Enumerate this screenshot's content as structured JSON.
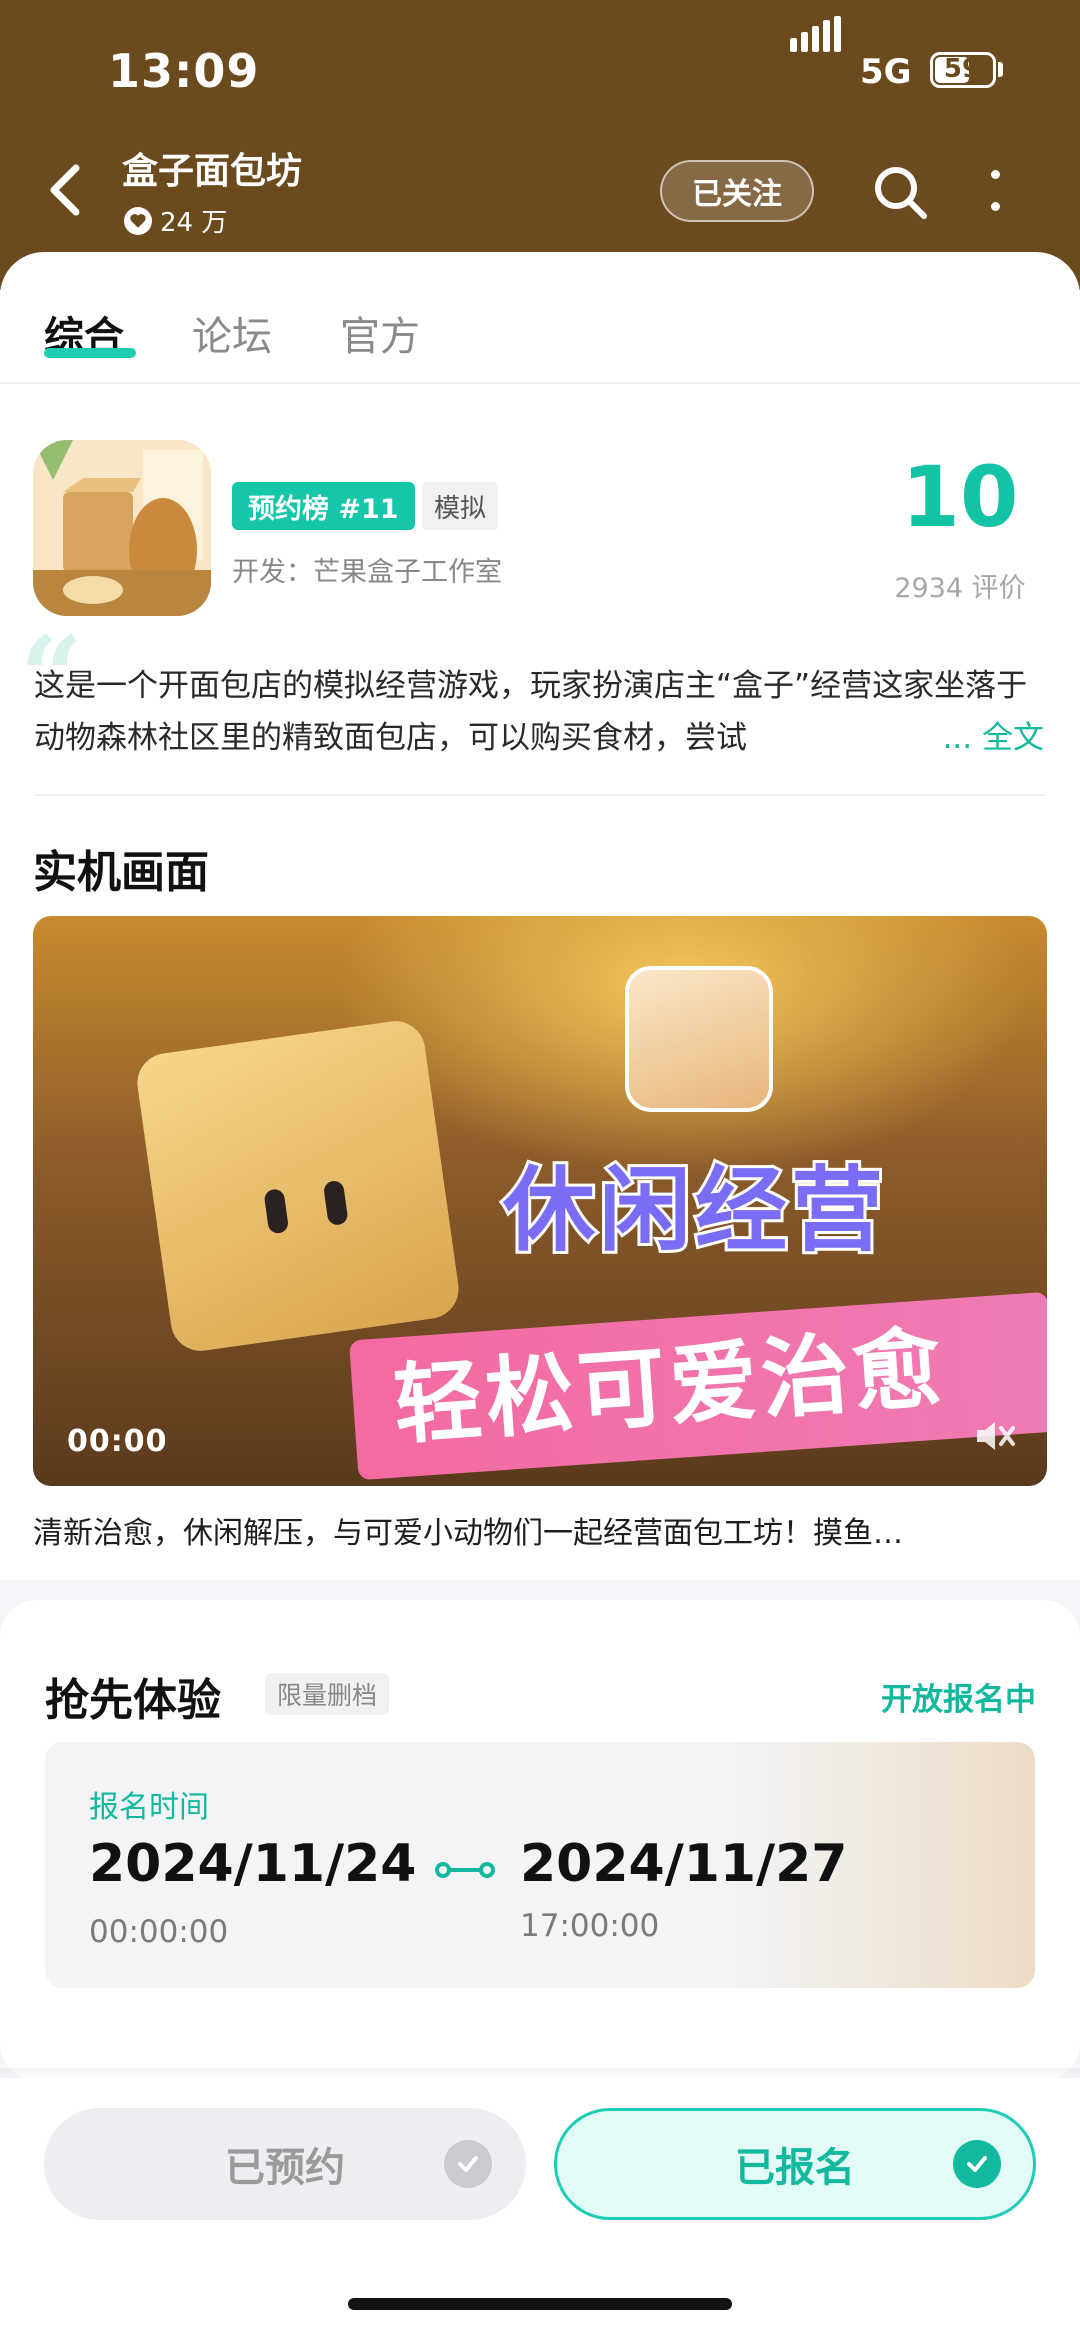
{
  "status_bar": {
    "time": "13:09",
    "network": "5G",
    "battery": "59"
  },
  "header": {
    "title": "盒子面包坊",
    "followers": "24 万",
    "follow_label": "已关注",
    "icons": [
      "back-icon",
      "heart-icon",
      "search-icon",
      "more-icon"
    ]
  },
  "tabs": [
    {
      "label": "综合",
      "active": true
    },
    {
      "label": "论坛",
      "active": false
    },
    {
      "label": "官方",
      "active": false
    }
  ],
  "game": {
    "rank_badge": "预约榜 #11",
    "genre": "模拟",
    "developer": "开发：芒果盒子工作室",
    "score": "10",
    "reviews": "2934 评价",
    "description": "这是一个开面包店的模拟经营游戏，玩家扮演店主“盒子”经营这家坐落于动物森林社区里的精致面包店，可以购买食材，尝试",
    "read_more": "... 全文"
  },
  "screenshots": {
    "title": "实机画面",
    "video_overlay_1": "休闲经营",
    "video_overlay_2": "轻松可爱治愈",
    "video_time": "00:00",
    "caption": "清新治愈，休闲解压，与可爱小动物们一起经营面包工坊！摸鱼…"
  },
  "early_access": {
    "title": "抢先体验",
    "tag": "限量删档",
    "status": "开放报名中",
    "reg_label": "报名时间",
    "start_date": "2024/11/24",
    "start_time": "00:00:00",
    "end_date": "2024/11/27",
    "end_time": "17:00:00"
  },
  "bottom": {
    "reserved_label": "已预约",
    "registered_label": "已报名"
  },
  "colors": {
    "header_bg": "#6b4a1d",
    "accent": "#13b99e",
    "rank_badge": "#16c6a8"
  }
}
